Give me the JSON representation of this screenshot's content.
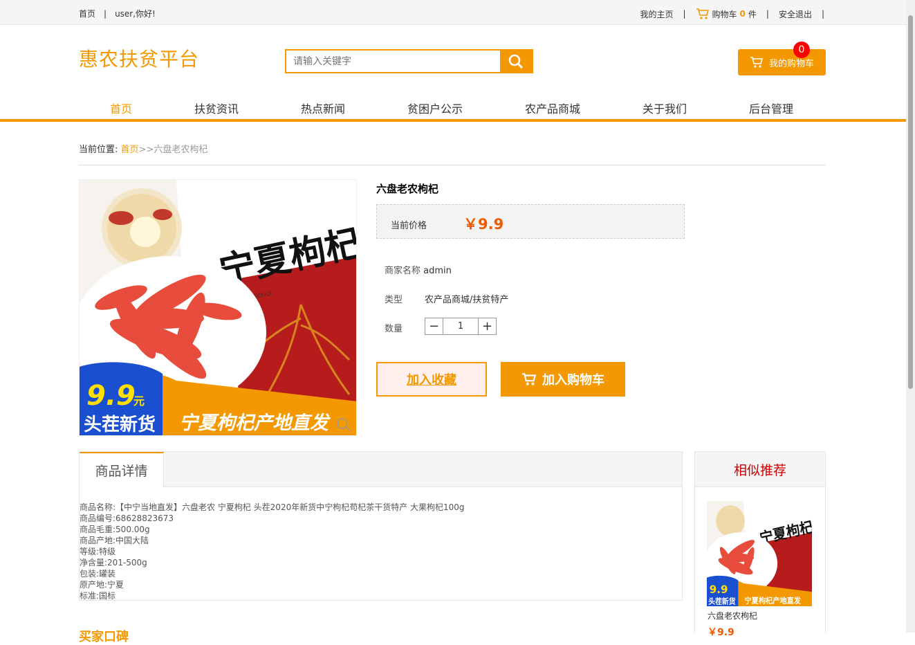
{
  "topbar": {
    "home": "首页",
    "sep": "|",
    "greeting": "user,你好!",
    "my_home": "我的主页",
    "cart_prefix": "购物车",
    "cart_count": "0",
    "cart_suffix": "件",
    "logout": "安全退出"
  },
  "header": {
    "logo": "惠农扶贫平台",
    "search_placeholder": "请输入关键字",
    "my_cart": "我的购物车",
    "cart_badge": "0"
  },
  "nav": [
    {
      "label": "首页",
      "active": true
    },
    {
      "label": "扶贫资讯"
    },
    {
      "label": "热点新闻"
    },
    {
      "label": "贫困户公示"
    },
    {
      "label": "农产品商城"
    },
    {
      "label": "关于我们"
    },
    {
      "label": "后台管理"
    }
  ],
  "breadcrumb": {
    "prefix": "当前位置:",
    "home": "首页",
    "arrow": ">>",
    "current": "六盘老农枸杞"
  },
  "product": {
    "title": "六盘老农枸杞",
    "price_label": "当前价格",
    "price": "￥9.9",
    "merchant_label": "商家名称",
    "merchant": "admin",
    "type_label": "类型",
    "type": "农产品商城/扶贫特产",
    "qty_label": "数量",
    "qty": "1",
    "fav_button": "加入收藏",
    "cart_button": "加入购物车",
    "image_text": {
      "brand": "宁夏枸杞",
      "pinyin": "NIN XIA GOUQI",
      "price_tag": "9.9",
      "yuan": "元",
      "tag": "头茬新货",
      "banner": "宁夏枸杞产地直发"
    }
  },
  "detail": {
    "tab": "商品详情",
    "lines": [
      "商品名称:【中宁当地直发】六盘老农 宁夏枸杞 头茬2020年新货中宁枸杞苟杞茶干货特产 大果枸杞100g",
      "商品编号:68628823673",
      "商品毛重:500.00g",
      "商品产地:中国大陆",
      "等级:特级",
      "净含量:201-500g",
      "包装:罐装",
      "原产地:宁夏",
      "标准:国标"
    ]
  },
  "recommend": {
    "title": "相似推荐",
    "name": "六盘老农枸杞",
    "price": "￥9.9"
  },
  "cut_heading": "买家口碑",
  "colors": {
    "accent": "#f39800",
    "price": "#f05a00",
    "badge": "#ff0000"
  }
}
